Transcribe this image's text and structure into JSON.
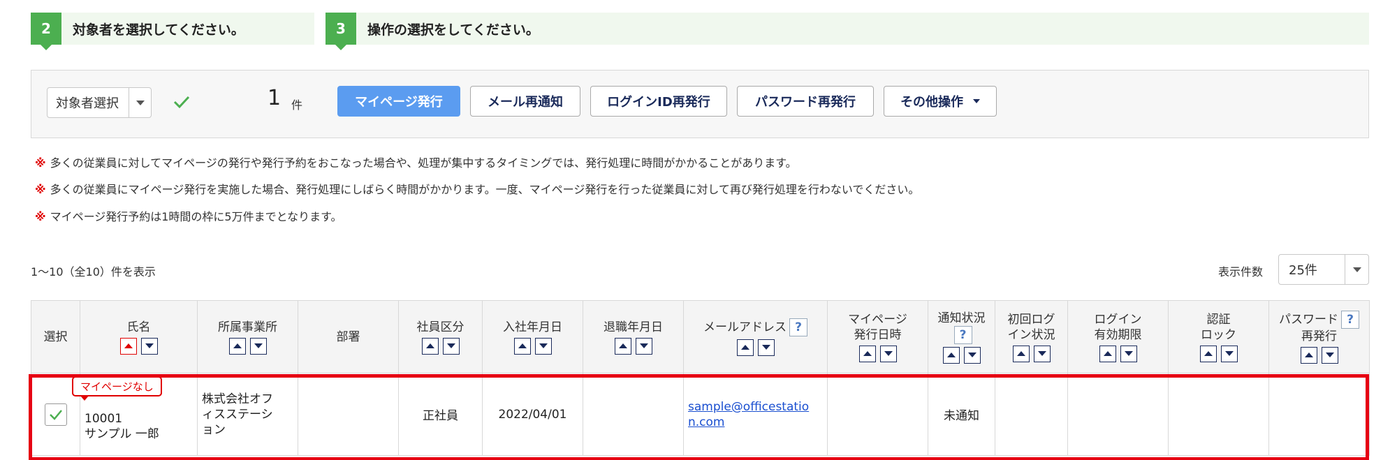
{
  "steps": [
    {
      "num": "2",
      "text": "対象者を選択してください。"
    },
    {
      "num": "3",
      "text": "操作の選択をしてください。"
    }
  ],
  "selector": {
    "label": "対象者選択",
    "count": "1",
    "unit": "件"
  },
  "actions": {
    "issue_mypage": "マイページ発行",
    "resend_mail": "メール再通知",
    "reissue_login_id": "ログインID再発行",
    "reissue_password": "パスワード再発行",
    "other": "その他操作"
  },
  "notes": [
    "多くの従業員に対してマイページの発行や発行予約をおこなった場合や、処理が集中するタイミングでは、発行処理に時間がかかることがあります。",
    "多くの従業員にマイページ発行を実施した場合、発行処理にしばらく時間がかかります。一度、マイページ発行を行った従業員に対して再び発行処理を行わないでください。",
    "マイページ発行予約は1時間の枠に5万件までとなります。"
  ],
  "note_mark": "※",
  "summary": "1～10（全10）件を表示",
  "per_page": {
    "label": "表示件数",
    "value": "25件"
  },
  "table": {
    "headers": {
      "select": "選択",
      "name": "氏名",
      "office": "所属事業所",
      "dept": "部署",
      "type": "社員区分",
      "join": "入社年月日",
      "leave": "退職年月日",
      "email": "メールアドレス",
      "mypage_l1": "マイページ",
      "mypage_l2": "発行日時",
      "notify": "通知状況",
      "firstlogin_l1": "初回ログ",
      "firstlogin_l2": "イン状況",
      "loginexp_l1": "ログイン",
      "loginexp_l2": "有効期限",
      "auth_l1": "認証",
      "auth_l2": "ロック",
      "pw_l1": "パスワード",
      "pw_l2": "再発行"
    },
    "help": "?",
    "row": {
      "badge": "マイページなし",
      "id": "10001",
      "name": "サンプル 一郎",
      "office_l1": "株式会社オフ",
      "office_l2": "ィスステーシ",
      "office_l3": "ョン",
      "dept": "",
      "type": "正社員",
      "join": "2022/04/01",
      "leave": "",
      "email_l1": "sample@officestatio",
      "email_l2": "n.com",
      "mypage": "",
      "notify": "未通知",
      "firstlogin": "",
      "loginexp": "",
      "auth": "",
      "pw": ""
    }
  },
  "colors": {
    "accent_green": "#4caf50",
    "primary_button": "#5b9cf0",
    "highlight": "#e60012"
  }
}
